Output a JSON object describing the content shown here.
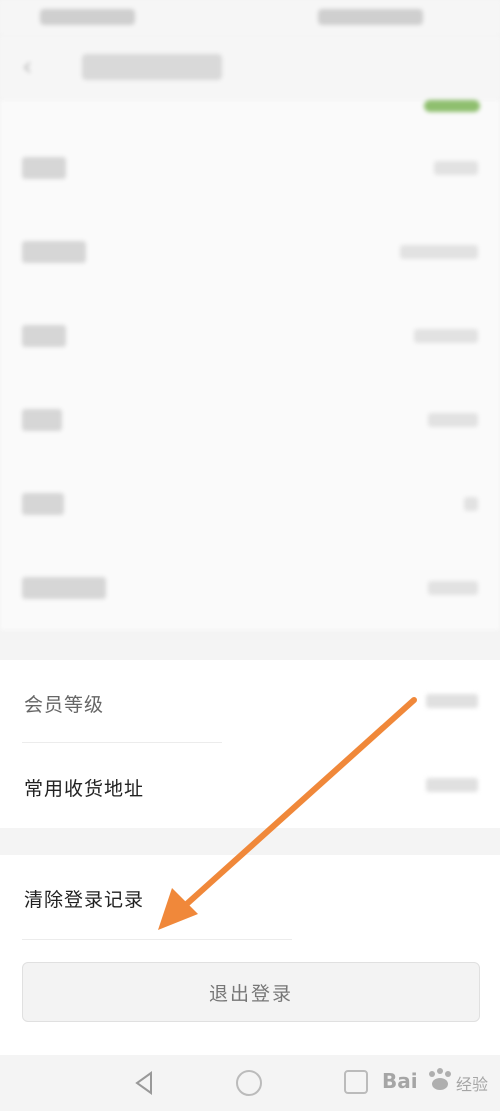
{
  "sections": {
    "account": {
      "member_level_label": "会员等级",
      "shipping_address_label": "常用收货地址"
    },
    "actions": {
      "clear_login_label": "清除登录记录",
      "logout_label": "退出登录"
    }
  },
  "colors": {
    "arrow": "#f0883a",
    "toggle": "#8fbf6f"
  },
  "icons": {
    "back": "chevron-left-icon",
    "nav_back": "triangle-back-icon",
    "nav_home": "circle-home-icon",
    "nav_recent": "square-recent-icon"
  }
}
